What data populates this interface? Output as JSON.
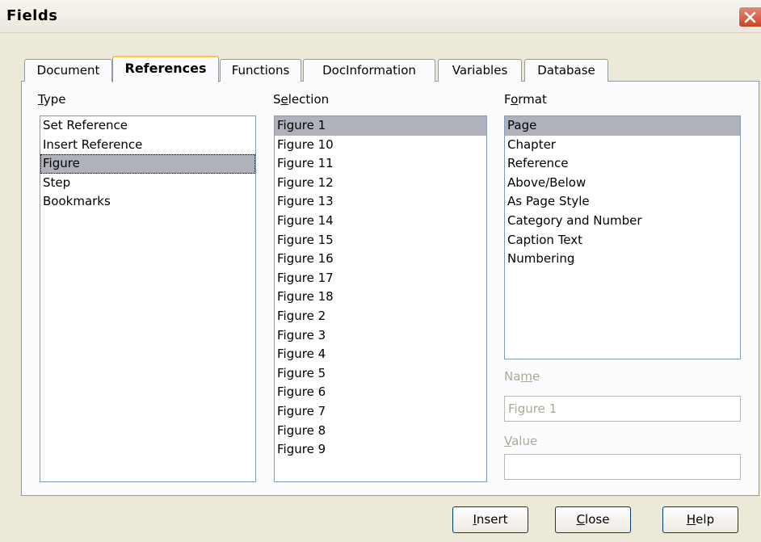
{
  "window": {
    "title": "Fields"
  },
  "tabs": [
    {
      "label": "Document"
    },
    {
      "label": "References"
    },
    {
      "label": "Functions"
    },
    {
      "label": "DocInformation"
    },
    {
      "label": "Variables"
    },
    {
      "label": "Database"
    }
  ],
  "type_panel": {
    "label": "Type",
    "items": [
      "Set Reference",
      "Insert Reference",
      "Figure",
      "Step",
      "Bookmarks"
    ],
    "selected": "Figure"
  },
  "selection_panel": {
    "label": "Selection",
    "items": [
      "Figure 1",
      "Figure 10",
      "Figure 11",
      "Figure 12",
      "Figure 13",
      "Figure 14",
      "Figure 15",
      "Figure 16",
      "Figure 17",
      "Figure 18",
      "Figure 2",
      "Figure 3",
      "Figure 4",
      "Figure 5",
      "Figure 6",
      "Figure 7",
      "Figure 8",
      "Figure 9"
    ],
    "selected": "Figure 1"
  },
  "format_panel": {
    "label": "Format",
    "items": [
      "Page",
      "Chapter",
      "Reference",
      "Above/Below",
      "As Page Style",
      "Category and Number",
      "Caption Text",
      "Numbering"
    ],
    "selected": "Page"
  },
  "name_field": {
    "label": "Name",
    "value": "Figure 1"
  },
  "value_field": {
    "label": "Value",
    "value": ""
  },
  "buttons": {
    "insert": "Insert",
    "close": "Close",
    "help": "Help"
  }
}
